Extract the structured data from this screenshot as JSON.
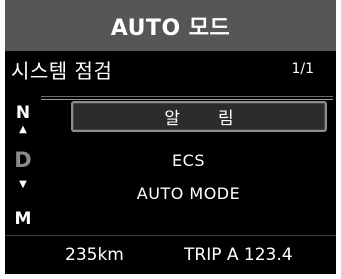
{
  "header": {
    "title": "AUTO 모드"
  },
  "screen": {
    "title": "시스템 점검",
    "page_indicator": "1/1",
    "gear": {
      "n": "N",
      "up": "▲",
      "d": "D",
      "down": "▼",
      "m": "M"
    },
    "alarm_label": "알림",
    "messages": [
      "ECS",
      "AUTO MODE"
    ]
  },
  "footer": {
    "distance": "235km",
    "trip": "TRIP A 123.4"
  },
  "colors": {
    "header_bg": "#565656",
    "screen_bg": "#000000",
    "text": "#ffffff",
    "inactive_gear": "#8a8a8a"
  }
}
